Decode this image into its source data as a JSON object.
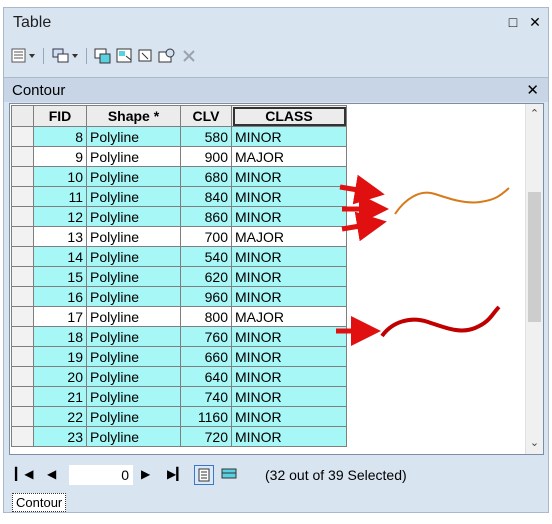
{
  "window": {
    "title": "Table"
  },
  "subheader": {
    "label": "Contour"
  },
  "columns": [
    "FID",
    "Shape *",
    "CLV",
    "CLASS"
  ],
  "rows": [
    {
      "fid": "8",
      "shape": "Polyline",
      "clv": "580",
      "cls": "MINOR",
      "selected": true
    },
    {
      "fid": "9",
      "shape": "Polyline",
      "clv": "900",
      "cls": "MAJOR",
      "selected": false
    },
    {
      "fid": "10",
      "shape": "Polyline",
      "clv": "680",
      "cls": "MINOR",
      "selected": true
    },
    {
      "fid": "11",
      "shape": "Polyline",
      "clv": "840",
      "cls": "MINOR",
      "selected": true
    },
    {
      "fid": "12",
      "shape": "Polyline",
      "clv": "860",
      "cls": "MINOR",
      "selected": true
    },
    {
      "fid": "13",
      "shape": "Polyline",
      "clv": "700",
      "cls": "MAJOR",
      "selected": false
    },
    {
      "fid": "14",
      "shape": "Polyline",
      "clv": "540",
      "cls": "MINOR",
      "selected": true
    },
    {
      "fid": "15",
      "shape": "Polyline",
      "clv": "620",
      "cls": "MINOR",
      "selected": true
    },
    {
      "fid": "16",
      "shape": "Polyline",
      "clv": "960",
      "cls": "MINOR",
      "selected": true
    },
    {
      "fid": "17",
      "shape": "Polyline",
      "clv": "800",
      "cls": "MAJOR",
      "selected": false
    },
    {
      "fid": "18",
      "shape": "Polyline",
      "clv": "760",
      "cls": "MINOR",
      "selected": true
    },
    {
      "fid": "19",
      "shape": "Polyline",
      "clv": "660",
      "cls": "MINOR",
      "selected": true
    },
    {
      "fid": "20",
      "shape": "Polyline",
      "clv": "640",
      "cls": "MINOR",
      "selected": true
    },
    {
      "fid": "21",
      "shape": "Polyline",
      "clv": "740",
      "cls": "MINOR",
      "selected": true
    },
    {
      "fid": "22",
      "shape": "Polyline",
      "clv": "1160",
      "cls": "MINOR",
      "selected": true
    },
    {
      "fid": "23",
      "shape": "Polyline",
      "clv": "720",
      "cls": "MINOR",
      "selected": true
    }
  ],
  "navigation": {
    "current_record": "0",
    "status": "(32 out of 39 Selected)"
  },
  "tab": {
    "label": "Contour"
  },
  "colors": {
    "selected_row": "#a8f7f7",
    "annotation_red": "#e01010",
    "minor_line": "#d77a1a",
    "major_line": "#c00000"
  },
  "icons": [
    "table-options-icon",
    "related-tables-icon",
    "select-by-attributes-icon",
    "switch-selection-icon",
    "clear-selection-icon",
    "zoom-to-selected-icon",
    "delete-selected-icon",
    "close-icon",
    "restore-icon"
  ]
}
